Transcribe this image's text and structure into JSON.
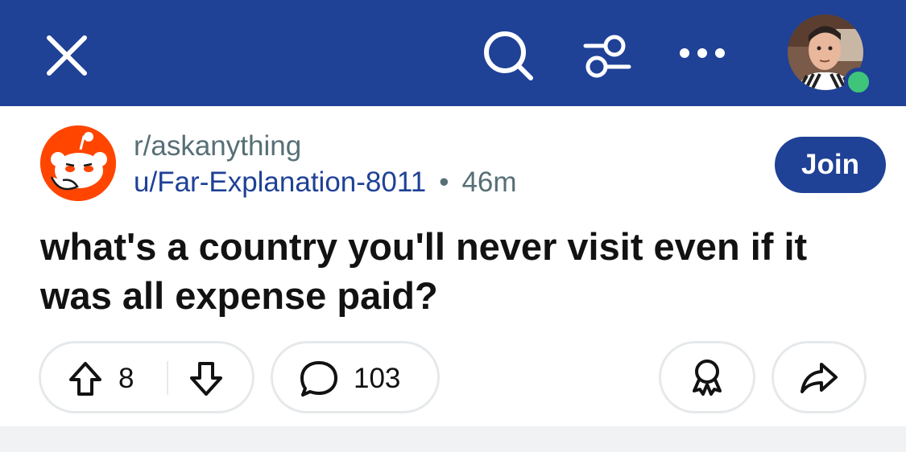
{
  "header": {
    "close_icon": "close-icon",
    "search_icon": "search-icon",
    "filter_icon": "filter-icon",
    "more_icon": "more-icon",
    "avatar_status": "online",
    "background": "#1f4196"
  },
  "post": {
    "subreddit": "r/askanything",
    "author": "u/Far-Explanation-8011",
    "separator": "•",
    "age": "46m",
    "join_label": "Join",
    "title": "what's a country you'll never visit even if it was all expense paid?",
    "upvotes": "8",
    "comments": "103"
  },
  "colors": {
    "brand": "#1f4196",
    "subreddit_icon": "#ff4500",
    "online": "#3fc57a"
  }
}
